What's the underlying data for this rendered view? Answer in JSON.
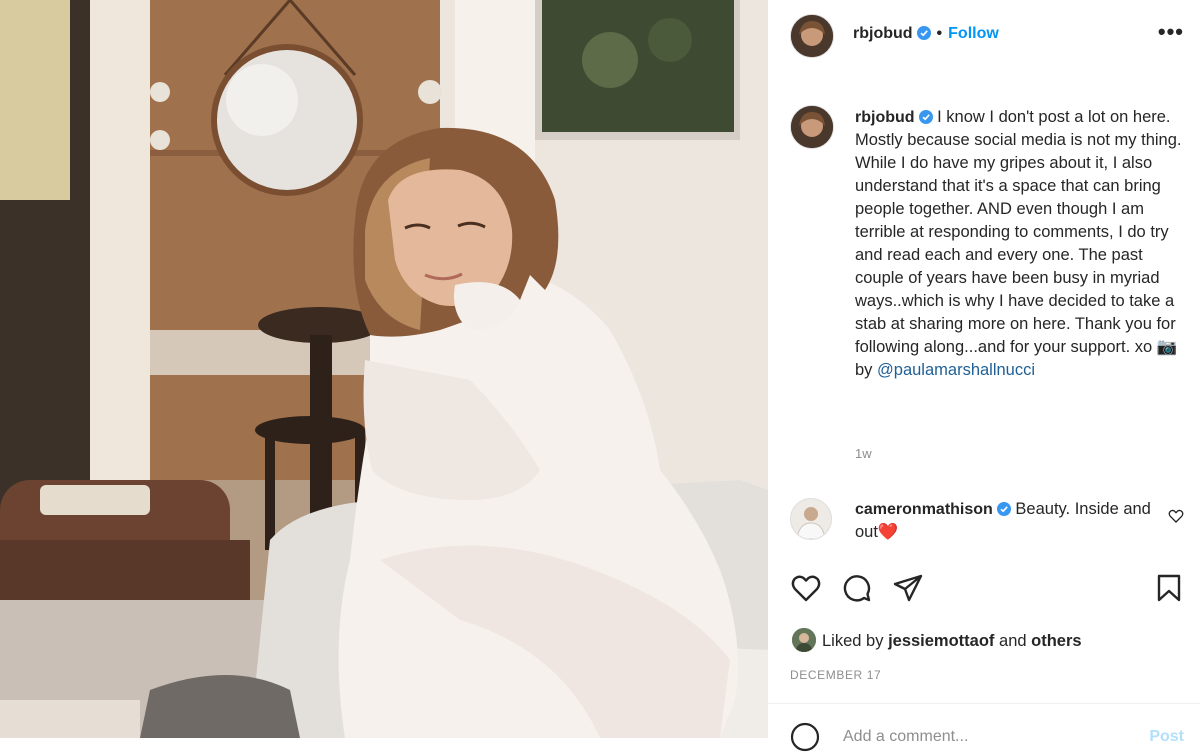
{
  "post": {
    "username": "rbjobud",
    "follow_label": "Follow",
    "separator": "•",
    "more_label": "•••",
    "caption_text": "I know I don't post a lot on here. Mostly because social media is not my thing. While I do have my gripes about it, I also understand that it's a space that can bring people together. AND even though I am terrible at responding to comments, I do try and read each and every one. The past couple of years have been busy in myriad ways..which is why I have decided to take a stab at sharing more on here. Thank you for following along...and for your support. xo 📷by",
    "caption_mention": "@paulamarshallnucci",
    "age": "1w"
  },
  "comments": [
    {
      "username": "cameronmathison",
      "text": "Beauty. Inside and out❤️"
    }
  ],
  "likes": {
    "prefix": "Liked by",
    "user": "jessiemottaof",
    "middle": "and",
    "suffix": "others"
  },
  "date": "DECEMBER 17",
  "add_comment": {
    "placeholder": "Add a comment...",
    "post_label": "Post"
  },
  "colors": {
    "accent": "#0095f6",
    "verified": "#3897f0",
    "heart": "#ed4956",
    "muted": "#8e8e8e"
  },
  "icons": [
    "verified-badge-icon",
    "more-icon",
    "heart-icon",
    "comment-icon",
    "share-icon",
    "bookmark-icon",
    "emoji-icon"
  ]
}
